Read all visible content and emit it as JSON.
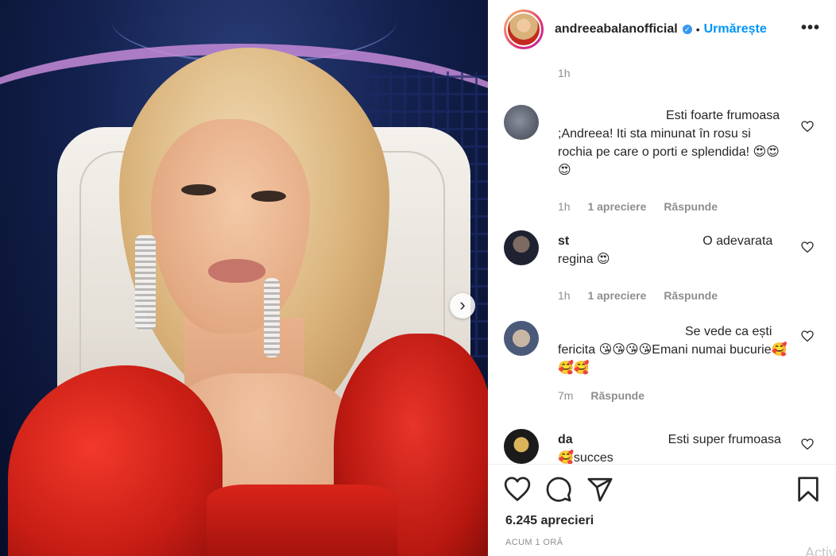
{
  "post": {
    "username": "andreeabalanofficial",
    "separator": "•",
    "follow_label": "Urmărește",
    "more_label": "•••",
    "caption_time": "1h",
    "likes": "6.245 aprecieri",
    "posted": "ACUM 1 ORĂ",
    "next_label": "›"
  },
  "comments": [
    {
      "user": "",
      "text": "Esti foarte frumoasa ;Andreea! Iti sta minunat în rosu si rochia pe care o porti e splendida! 😍😍😍",
      "time": "1h",
      "likes": "1 apreciere",
      "reply": "Răspunde"
    },
    {
      "user": "st",
      "text": "O adevarata regina 😍",
      "time": "1h",
      "likes": "1 apreciere",
      "reply": "Răspunde"
    },
    {
      "user": "",
      "text": "Se vede ca ești fericita 😘😘😘😘Emani numai bucurie🥰🥰🥰",
      "time": "7m",
      "likes": "",
      "reply": "Răspunde"
    },
    {
      "user": "da",
      "text": "Esti super frumoasa 🥰succes",
      "time": "",
      "likes": "",
      "reply": ""
    }
  ],
  "watermark": "Activ",
  "colors": {
    "accent": "#0095f6",
    "muted": "#8e8e8e",
    "text": "#262626",
    "dress": "#d9241a"
  },
  "icons": [
    "heart-icon",
    "comment-icon",
    "share-icon",
    "save-icon",
    "verified-icon",
    "more-icon",
    "chevron-right-icon"
  ]
}
